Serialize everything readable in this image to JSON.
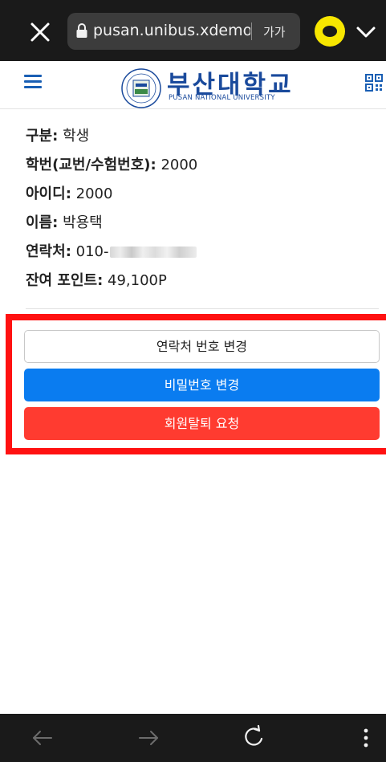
{
  "browser": {
    "url": "pusan.unibus.xdemo.",
    "text_size_label": "가가",
    "icons": {
      "close": "close-icon",
      "lock": "lock-icon",
      "kakao": "kakaotalk-icon",
      "chevron": "chevron-down-icon",
      "back": "arrow-left-icon",
      "forward": "arrow-right-icon",
      "reload": "reload-icon",
      "more": "more-vertical-icon"
    }
  },
  "header": {
    "brand_name": "부산대학교",
    "brand_subtitle": "PUSAN NATIONAL UNIVERSITY",
    "icons": {
      "menu": "hamburger-menu-icon",
      "emblem": "university-emblem",
      "qr": "qr-code-icon"
    }
  },
  "profile": {
    "rows": [
      {
        "label": "구분",
        "value": "학생"
      },
      {
        "label": "학번(교번/수험번호)",
        "value": "2000"
      },
      {
        "label": "아이디",
        "value": "2000"
      },
      {
        "label": "이름",
        "value": "박용택"
      },
      {
        "label": "연락처",
        "value": "010-"
      },
      {
        "label": "잔여 포인트",
        "value": "49,100P"
      }
    ],
    "separator": ":"
  },
  "actions": {
    "change_phone": "연락처 번호 변경",
    "change_password": "비밀번호 변경",
    "withdraw": "회원탈퇴 요청"
  },
  "colors": {
    "brand_blue": "#1a4a9c",
    "primary_button": "#0a7cf0",
    "danger_button": "#ff3b30",
    "highlight_frame": "#ff1111",
    "kakao_yellow": "#f7e600"
  }
}
